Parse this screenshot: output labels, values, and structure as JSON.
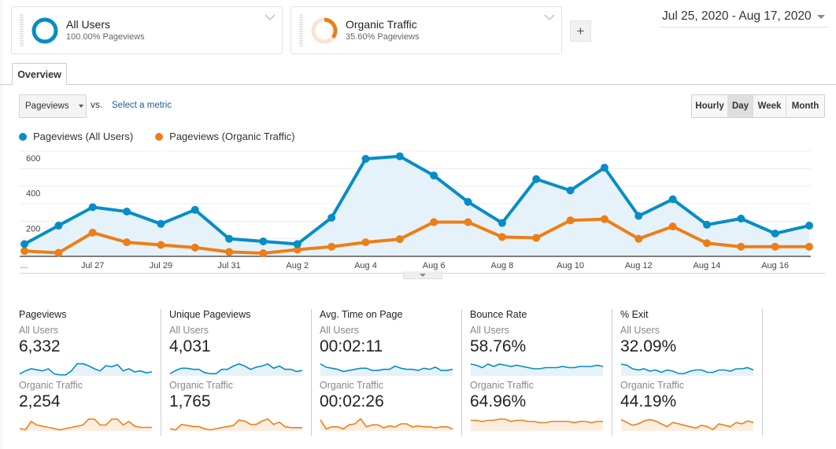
{
  "segments": [
    {
      "name": "All Users",
      "subtitle": "100.00% Pageviews",
      "share": 1.0,
      "color": "#058dc7"
    },
    {
      "name": "Organic Traffic",
      "subtitle": "35.60% Pageviews",
      "share": 0.356,
      "color": "#ed7e17"
    }
  ],
  "add_segment_label": "+",
  "date_range": "Jul 25, 2020 - Aug 17, 2020",
  "tabs": [
    {
      "label": "Overview",
      "active": true
    }
  ],
  "metric_selector": {
    "selected": "Pageviews",
    "vs_label": "vs.",
    "secondary_link": "Select a metric"
  },
  "granularity": [
    {
      "label": "Hourly",
      "active": false
    },
    {
      "label": "Day",
      "active": true
    },
    {
      "label": "Week",
      "active": false
    },
    {
      "label": "Month",
      "active": false
    }
  ],
  "chart_data": {
    "type": "line",
    "legend": [
      {
        "name": "Pageviews (All Users)",
        "color": "#058dc7"
      },
      {
        "name": "Pageviews (Organic Traffic)",
        "color": "#ed7e17"
      }
    ],
    "x": [
      "Jul 25",
      "Jul 26",
      "Jul 27",
      "Jul 28",
      "Jul 29",
      "Jul 30",
      "Jul 31",
      "Aug 1",
      "Aug 2",
      "Aug 3",
      "Aug 4",
      "Aug 5",
      "Aug 6",
      "Aug 7",
      "Aug 8",
      "Aug 9",
      "Aug 10",
      "Aug 11",
      "Aug 12",
      "Aug 13",
      "Aug 14",
      "Aug 15",
      "Aug 16",
      "Aug 17"
    ],
    "x_tick_labels": [
      {
        "index": 0,
        "label": "…"
      },
      {
        "index": 2,
        "label": "Jul 27"
      },
      {
        "index": 4,
        "label": "Jul 29"
      },
      {
        "index": 6,
        "label": "Jul 31"
      },
      {
        "index": 8,
        "label": "Aug 2"
      },
      {
        "index": 10,
        "label": "Aug 4"
      },
      {
        "index": 12,
        "label": "Aug 6"
      },
      {
        "index": 14,
        "label": "Aug 8"
      },
      {
        "index": 16,
        "label": "Aug 10"
      },
      {
        "index": 18,
        "label": "Aug 12"
      },
      {
        "index": 20,
        "label": "Aug 14"
      },
      {
        "index": 22,
        "label": "Aug 16"
      }
    ],
    "series": [
      {
        "name": "Pageviews (All Users)",
        "color": "#058dc7",
        "filled": true,
        "values": [
          70,
          175,
          280,
          255,
          185,
          265,
          100,
          85,
          70,
          220,
          555,
          570,
          460,
          310,
          190,
          440,
          375,
          505,
          230,
          325,
          180,
          215,
          130,
          175
        ]
      },
      {
        "name": "Pageviews (Organic Traffic)",
        "color": "#ed7e17",
        "filled": false,
        "values": [
          30,
          20,
          135,
          80,
          65,
          50,
          25,
          18,
          38,
          55,
          80,
          98,
          195,
          195,
          110,
          105,
          205,
          212,
          100,
          170,
          75,
          55,
          55,
          55
        ]
      }
    ],
    "y_ticks": [
      200,
      400,
      600
    ],
    "ylim": [
      0,
      600
    ],
    "grid": true,
    "legend_position": "top-left",
    "title": "",
    "xlabel": "",
    "ylabel": ""
  },
  "metric_cards": [
    {
      "title": "Pageviews",
      "rows": [
        {
          "segment": "All Users",
          "value": "6,332",
          "trend": [
            2,
            5,
            7,
            6,
            5,
            7,
            2,
            1,
            1,
            5,
            12,
            12,
            10,
            7,
            5,
            10,
            9,
            11,
            5,
            7,
            4,
            5,
            3,
            4
          ]
        },
        {
          "segment": "Organic Traffic",
          "value": "2,254",
          "trend": [
            2,
            1,
            8,
            5,
            4,
            3,
            2,
            1,
            2,
            3,
            4,
            5,
            10,
            10,
            5,
            5,
            10,
            10,
            5,
            8,
            4,
            3,
            3,
            3
          ]
        }
      ]
    },
    {
      "title": "Unique Pageviews",
      "rows": [
        {
          "segment": "All Users",
          "value": "4,031",
          "trend": [
            2,
            5,
            7,
            7,
            6,
            6,
            3,
            2,
            2,
            6,
            6,
            9,
            11,
            9,
            6,
            8,
            9,
            11,
            7,
            9,
            6,
            6,
            4,
            5
          ]
        },
        {
          "segment": "Organic Traffic",
          "value": "1,765",
          "trend": [
            2,
            1,
            6,
            5,
            4,
            4,
            2,
            1,
            2,
            3,
            4,
            5,
            10,
            9,
            6,
            6,
            9,
            11,
            6,
            8,
            4,
            3,
            3,
            3
          ]
        }
      ]
    },
    {
      "title": "Avg. Time on Page",
      "rows": [
        {
          "segment": "All Users",
          "value": "00:02:11",
          "trend": [
            11,
            8,
            7,
            6,
            4,
            5,
            6,
            7,
            7,
            5,
            5,
            6,
            6,
            9,
            7,
            6,
            6,
            5,
            7,
            6,
            8,
            5,
            5,
            6
          ]
        },
        {
          "segment": "Organic Traffic",
          "value": "00:02:26",
          "trend": [
            11,
            2,
            4,
            4,
            2,
            6,
            7,
            12,
            4,
            6,
            6,
            3,
            5,
            4,
            7,
            7,
            4,
            5,
            4,
            4,
            3,
            4,
            4,
            2
          ]
        }
      ]
    },
    {
      "title": "Bounce Rate",
      "rows": [
        {
          "segment": "All Users",
          "value": "58.76%",
          "trend": [
            10,
            9,
            7,
            10,
            8,
            10,
            9,
            8,
            9,
            8,
            7,
            6,
            6,
            7,
            7,
            7,
            8,
            7,
            7,
            8,
            8,
            8,
            9,
            8
          ]
        },
        {
          "segment": "Organic Traffic",
          "value": "64.96%",
          "trend": [
            9,
            9,
            8,
            9,
            9,
            10,
            10,
            8,
            9,
            9,
            8,
            8,
            7,
            7,
            8,
            8,
            8,
            8,
            7,
            8,
            8,
            7,
            8,
            8
          ]
        }
      ]
    },
    {
      "title": "% Exit",
      "rows": [
        {
          "segment": "All Users",
          "value": "32.09%",
          "trend": [
            10,
            9,
            6,
            5,
            6,
            4,
            5,
            3,
            5,
            4,
            2,
            2,
            4,
            5,
            5,
            3,
            3,
            5,
            5,
            4,
            6,
            6,
            7,
            5
          ]
        },
        {
          "segment": "Organic Traffic",
          "value": "44.19%",
          "trend": [
            8,
            6,
            4,
            5,
            7,
            8,
            7,
            5,
            3,
            6,
            5,
            4,
            3,
            2,
            4,
            3,
            1,
            5,
            4,
            3,
            6,
            5,
            7,
            6
          ]
        }
      ]
    }
  ]
}
